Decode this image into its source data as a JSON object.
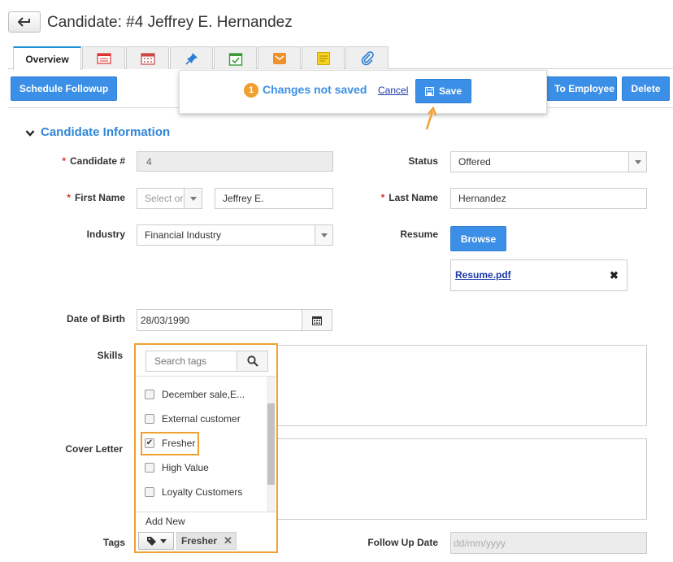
{
  "header": {
    "title": "Candidate: #4 Jeffrey E. Hernandez"
  },
  "tabs": [
    {
      "label": "Overview",
      "icon": "overview"
    },
    {
      "label": "",
      "icon": "details-icon"
    },
    {
      "label": "",
      "icon": "calendar-icon"
    },
    {
      "label": "",
      "icon": "pin-icon"
    },
    {
      "label": "",
      "icon": "task-icon"
    },
    {
      "label": "",
      "icon": "mail-icon"
    },
    {
      "label": "",
      "icon": "note-icon"
    },
    {
      "label": "",
      "icon": "attachment-icon"
    }
  ],
  "actions": {
    "schedule": "Schedule Followup",
    "convert": "To Employee",
    "delete": "Delete"
  },
  "unsaved": {
    "count": "1",
    "text": "Changes not saved",
    "cancel": "Cancel",
    "save": "Save"
  },
  "section": {
    "title": "Candidate Information"
  },
  "fields": {
    "candidate_no_label": "Candidate #",
    "candidate_no": "4",
    "status_label": "Status",
    "status": "Offered",
    "first_name_label": "First Name",
    "salutation_placeholder": "Select or",
    "first_name": "Jeffrey E.",
    "last_name_label": "Last Name",
    "last_name": "Hernandez",
    "industry_label": "Industry",
    "industry": "Financial Industry",
    "resume_label": "Resume",
    "browse": "Browse",
    "resume_file": "Resume.pdf",
    "dob_label": "Date of Birth",
    "dob": "28/03/1990",
    "skills_label": "Skills",
    "cover_label": "Cover Letter",
    "tags_label": "Tags",
    "follow_label": "Follow Up Date",
    "follow_placeholder": "dd/mm/yyyy"
  },
  "tags_dropdown": {
    "search_placeholder": "Search tags",
    "items": [
      {
        "label": "December sale,E...",
        "checked": false
      },
      {
        "label": "External customer",
        "checked": false
      },
      {
        "label": "Fresher",
        "checked": true
      },
      {
        "label": "High Value",
        "checked": false
      },
      {
        "label": "Loyalty Customers",
        "checked": false
      }
    ],
    "add_new": "Add New",
    "selected_tag": "Fresher"
  },
  "colors": {
    "accent": "#3b8fe6",
    "highlight": "#f0a030",
    "required": "#d9342b",
    "section": "#2f86d8"
  }
}
